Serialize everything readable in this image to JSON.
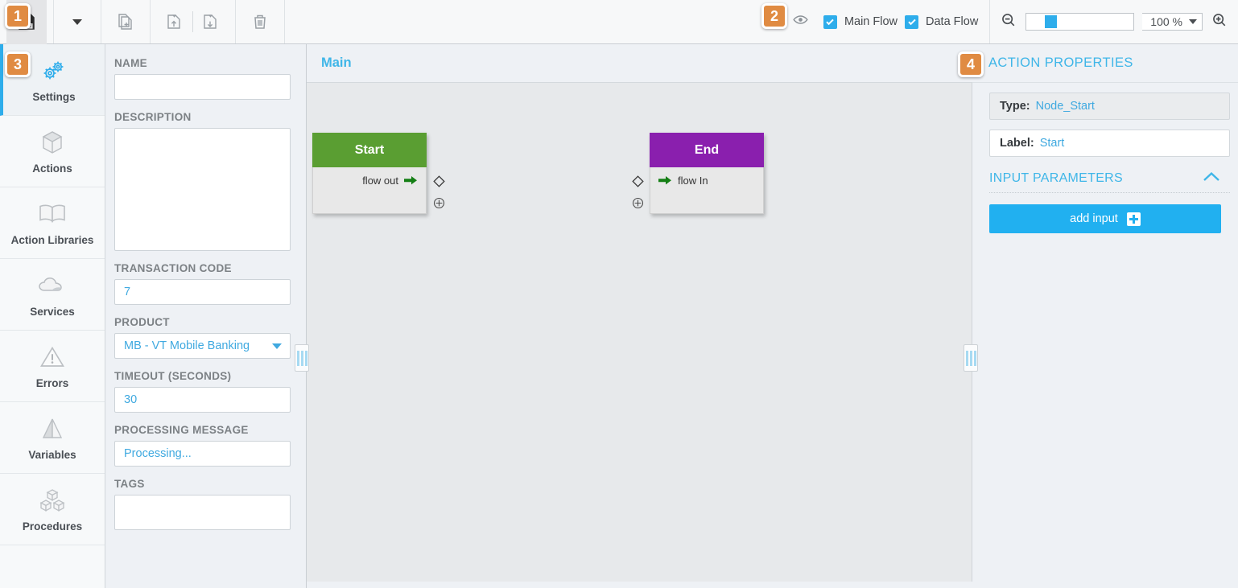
{
  "badges": {
    "b1": "1",
    "b2": "2",
    "b3": "3",
    "b4": "4"
  },
  "colors": {
    "accent": "#2eadeb",
    "badge": "#e08b42",
    "start_node": "#5a9e32",
    "end_node": "#8a1fae",
    "link_text": "#3fa9e0"
  },
  "toolbar": {
    "save_icon": "save-icon",
    "dropdown_icon": "chevron-down-icon",
    "new_icon": "new-document-icon",
    "import_icon": "import-icon",
    "export_icon": "export-icon",
    "delete_icon": "trash-icon",
    "visibility_icon": "eye-icon",
    "main_flow_label": "Main Flow",
    "data_flow_label": "Data Flow",
    "main_flow_checked": true,
    "data_flow_checked": true,
    "zoom_out_icon": "zoom-out-icon",
    "zoom_in_icon": "zoom-in-icon",
    "zoom_level": "100 %",
    "zoom_slider_value": 25
  },
  "sidebar": {
    "items": [
      {
        "label": "Settings",
        "icon": "gears-icon",
        "active": true
      },
      {
        "label": "Actions",
        "icon": "cube-icon",
        "active": false
      },
      {
        "label": "Action Libraries",
        "icon": "book-icon",
        "active": false
      },
      {
        "label": "Services",
        "icon": "cloud-icon",
        "active": false
      },
      {
        "label": "Errors",
        "icon": "warning-icon",
        "active": false
      },
      {
        "label": "Variables",
        "icon": "pyramid-icon",
        "active": false
      },
      {
        "label": "Procedures",
        "icon": "blocks-icon",
        "active": false
      }
    ]
  },
  "settings_form": {
    "fields": [
      {
        "label": "NAME",
        "value": "",
        "type": "text"
      },
      {
        "label": "DESCRIPTION",
        "value": "",
        "type": "textarea"
      },
      {
        "label": "TRANSACTION CODE",
        "value": "7",
        "type": "text"
      },
      {
        "label": "PRODUCT",
        "value": "MB - VT Mobile Banking",
        "type": "select"
      },
      {
        "label": "TIMEOUT (SECONDS)",
        "value": "30",
        "type": "text"
      },
      {
        "label": "PROCESSING MESSAGE",
        "value": "Processing...",
        "type": "text"
      },
      {
        "label": "TAGS",
        "value": "",
        "type": "textarea"
      }
    ]
  },
  "canvas": {
    "tab_label": "Main",
    "nodes": [
      {
        "title": "Start",
        "port_label": "flow out",
        "port_side": "right",
        "color": "#5a9e32"
      },
      {
        "title": "End",
        "port_label": "flow In",
        "port_side": "left",
        "color": "#8a1fae"
      }
    ],
    "connector_icons": {
      "diamond": "diamond-connector-icon",
      "plus": "add-connector-icon"
    }
  },
  "properties": {
    "title": "ACTION PROPERTIES",
    "type_key": "Type:",
    "type_value": "Node_Start",
    "label_key": "Label:",
    "label_value": "Start",
    "input_parameters_title": "INPUT PARAMETERS",
    "collapse_icon": "chevron-up-icon",
    "add_input_label": "add input"
  }
}
